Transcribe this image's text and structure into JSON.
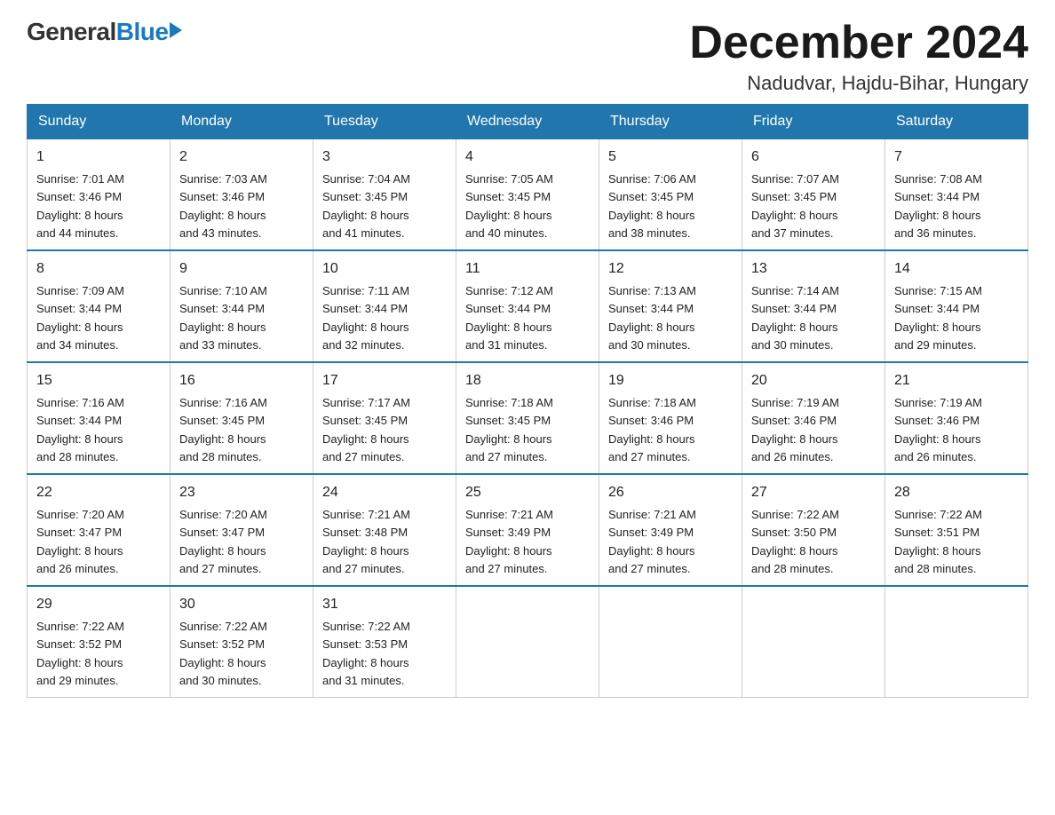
{
  "logo": {
    "general": "General",
    "blue": "Blue"
  },
  "header": {
    "month_year": "December 2024",
    "location": "Nadudvar, Hajdu-Bihar, Hungary"
  },
  "days_of_week": [
    "Sunday",
    "Monday",
    "Tuesday",
    "Wednesday",
    "Thursday",
    "Friday",
    "Saturday"
  ],
  "weeks": [
    [
      {
        "day": "1",
        "sunrise": "7:01 AM",
        "sunset": "3:46 PM",
        "daylight": "8 hours and 44 minutes."
      },
      {
        "day": "2",
        "sunrise": "7:03 AM",
        "sunset": "3:46 PM",
        "daylight": "8 hours and 43 minutes."
      },
      {
        "day": "3",
        "sunrise": "7:04 AM",
        "sunset": "3:45 PM",
        "daylight": "8 hours and 41 minutes."
      },
      {
        "day": "4",
        "sunrise": "7:05 AM",
        "sunset": "3:45 PM",
        "daylight": "8 hours and 40 minutes."
      },
      {
        "day": "5",
        "sunrise": "7:06 AM",
        "sunset": "3:45 PM",
        "daylight": "8 hours and 38 minutes."
      },
      {
        "day": "6",
        "sunrise": "7:07 AM",
        "sunset": "3:45 PM",
        "daylight": "8 hours and 37 minutes."
      },
      {
        "day": "7",
        "sunrise": "7:08 AM",
        "sunset": "3:44 PM",
        "daylight": "8 hours and 36 minutes."
      }
    ],
    [
      {
        "day": "8",
        "sunrise": "7:09 AM",
        "sunset": "3:44 PM",
        "daylight": "8 hours and 34 minutes."
      },
      {
        "day": "9",
        "sunrise": "7:10 AM",
        "sunset": "3:44 PM",
        "daylight": "8 hours and 33 minutes."
      },
      {
        "day": "10",
        "sunrise": "7:11 AM",
        "sunset": "3:44 PM",
        "daylight": "8 hours and 32 minutes."
      },
      {
        "day": "11",
        "sunrise": "7:12 AM",
        "sunset": "3:44 PM",
        "daylight": "8 hours and 31 minutes."
      },
      {
        "day": "12",
        "sunrise": "7:13 AM",
        "sunset": "3:44 PM",
        "daylight": "8 hours and 30 minutes."
      },
      {
        "day": "13",
        "sunrise": "7:14 AM",
        "sunset": "3:44 PM",
        "daylight": "8 hours and 30 minutes."
      },
      {
        "day": "14",
        "sunrise": "7:15 AM",
        "sunset": "3:44 PM",
        "daylight": "8 hours and 29 minutes."
      }
    ],
    [
      {
        "day": "15",
        "sunrise": "7:16 AM",
        "sunset": "3:44 PM",
        "daylight": "8 hours and 28 minutes."
      },
      {
        "day": "16",
        "sunrise": "7:16 AM",
        "sunset": "3:45 PM",
        "daylight": "8 hours and 28 minutes."
      },
      {
        "day": "17",
        "sunrise": "7:17 AM",
        "sunset": "3:45 PM",
        "daylight": "8 hours and 27 minutes."
      },
      {
        "day": "18",
        "sunrise": "7:18 AM",
        "sunset": "3:45 PM",
        "daylight": "8 hours and 27 minutes."
      },
      {
        "day": "19",
        "sunrise": "7:18 AM",
        "sunset": "3:46 PM",
        "daylight": "8 hours and 27 minutes."
      },
      {
        "day": "20",
        "sunrise": "7:19 AM",
        "sunset": "3:46 PM",
        "daylight": "8 hours and 26 minutes."
      },
      {
        "day": "21",
        "sunrise": "7:19 AM",
        "sunset": "3:46 PM",
        "daylight": "8 hours and 26 minutes."
      }
    ],
    [
      {
        "day": "22",
        "sunrise": "7:20 AM",
        "sunset": "3:47 PM",
        "daylight": "8 hours and 26 minutes."
      },
      {
        "day": "23",
        "sunrise": "7:20 AM",
        "sunset": "3:47 PM",
        "daylight": "8 hours and 27 minutes."
      },
      {
        "day": "24",
        "sunrise": "7:21 AM",
        "sunset": "3:48 PM",
        "daylight": "8 hours and 27 minutes."
      },
      {
        "day": "25",
        "sunrise": "7:21 AM",
        "sunset": "3:49 PM",
        "daylight": "8 hours and 27 minutes."
      },
      {
        "day": "26",
        "sunrise": "7:21 AM",
        "sunset": "3:49 PM",
        "daylight": "8 hours and 27 minutes."
      },
      {
        "day": "27",
        "sunrise": "7:22 AM",
        "sunset": "3:50 PM",
        "daylight": "8 hours and 28 minutes."
      },
      {
        "day": "28",
        "sunrise": "7:22 AM",
        "sunset": "3:51 PM",
        "daylight": "8 hours and 28 minutes."
      }
    ],
    [
      {
        "day": "29",
        "sunrise": "7:22 AM",
        "sunset": "3:52 PM",
        "daylight": "8 hours and 29 minutes."
      },
      {
        "day": "30",
        "sunrise": "7:22 AM",
        "sunset": "3:52 PM",
        "daylight": "8 hours and 30 minutes."
      },
      {
        "day": "31",
        "sunrise": "7:22 AM",
        "sunset": "3:53 PM",
        "daylight": "8 hours and 31 minutes."
      },
      null,
      null,
      null,
      null
    ]
  ],
  "labels": {
    "sunrise": "Sunrise:",
    "sunset": "Sunset:",
    "daylight": "Daylight:"
  }
}
